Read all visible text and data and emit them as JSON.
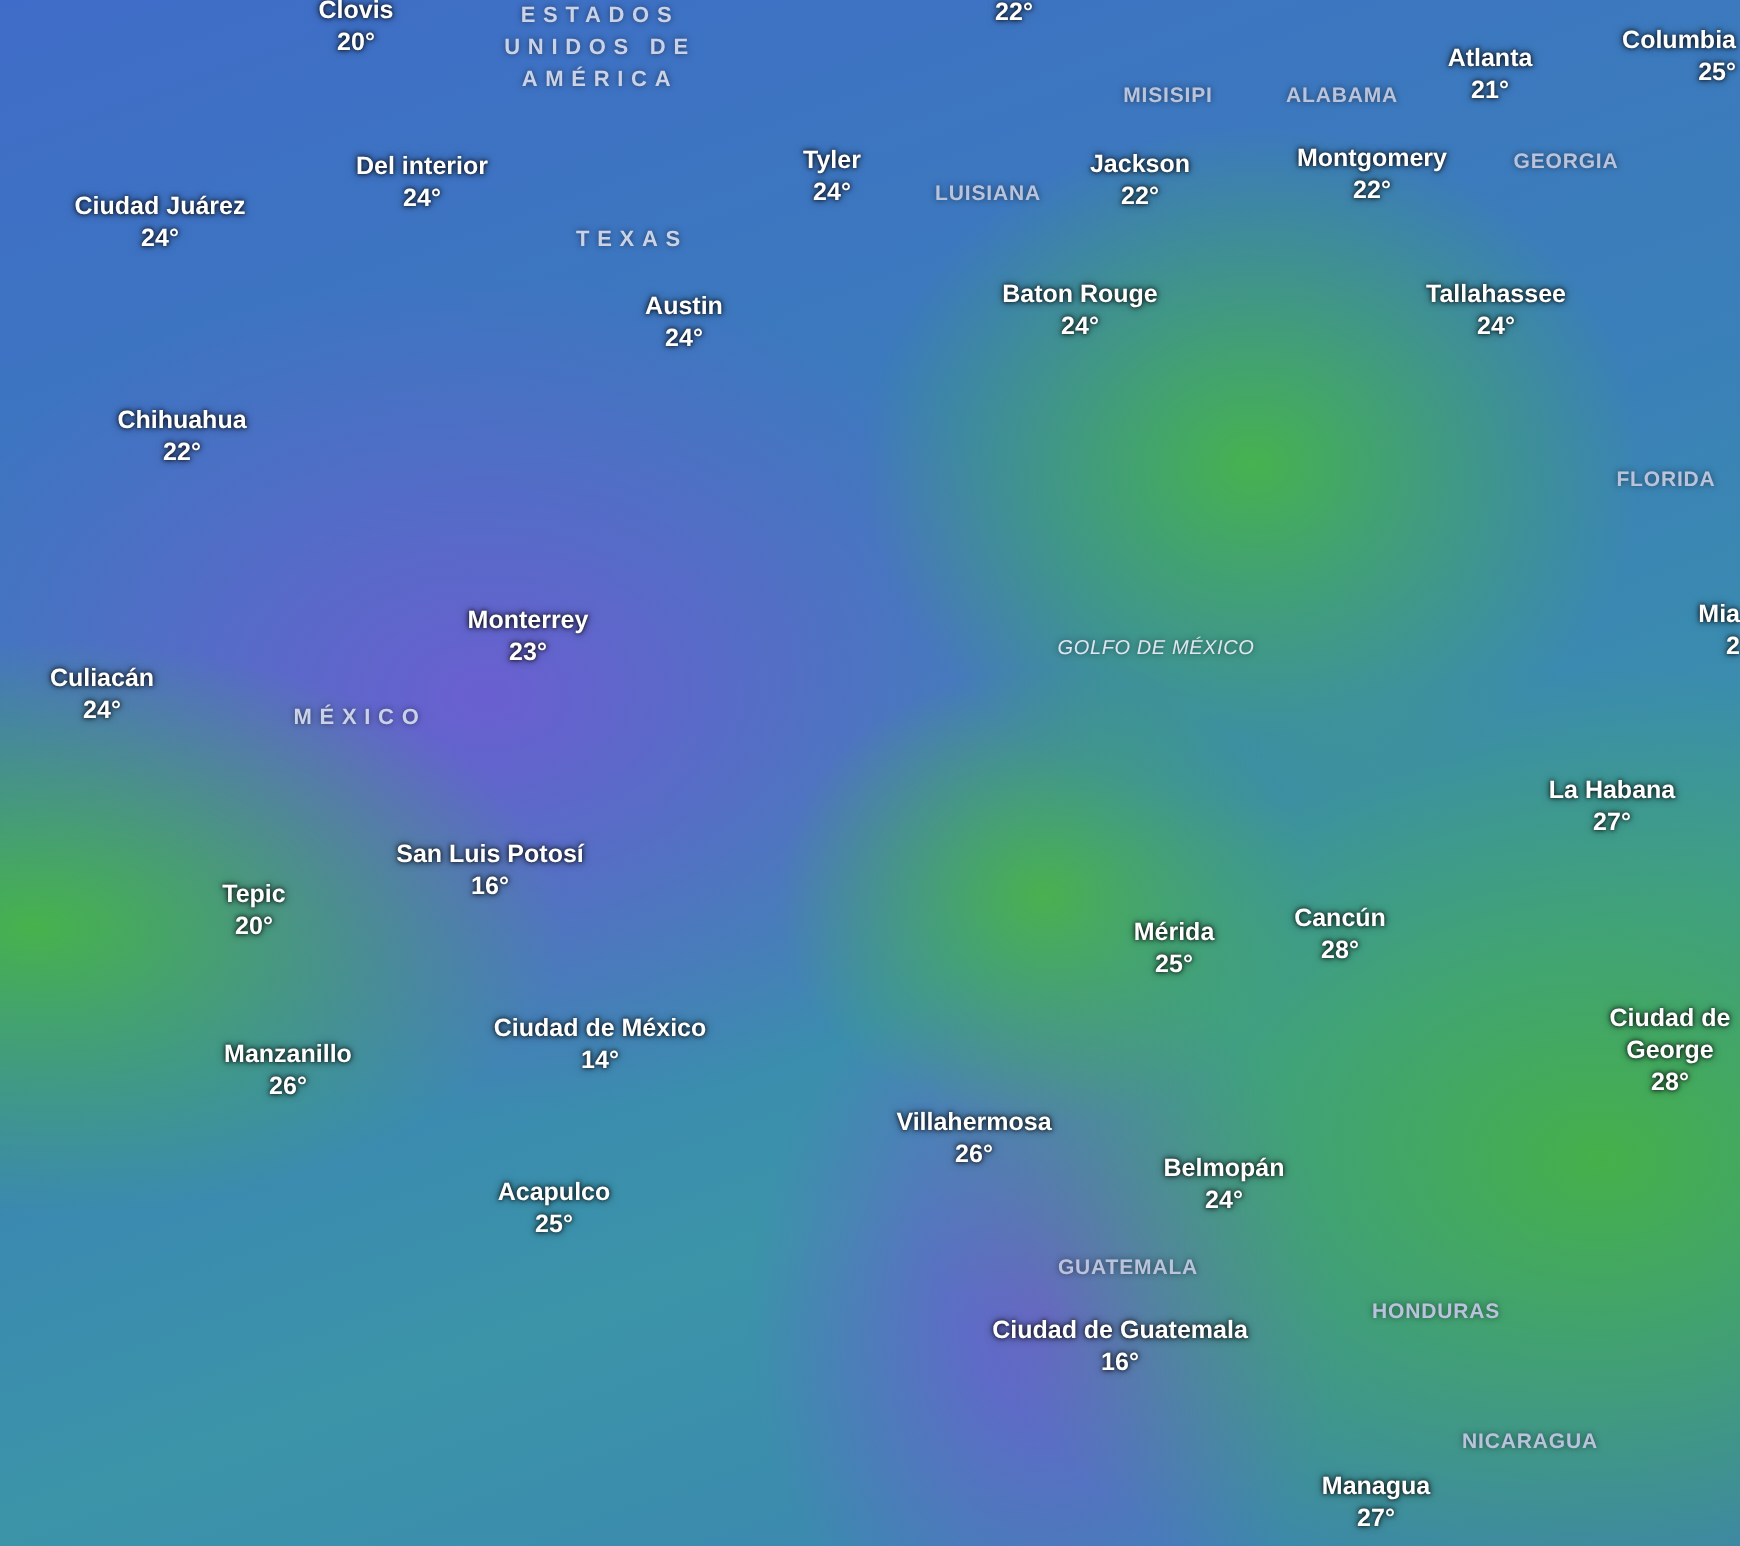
{
  "cities": [
    {
      "kind": "city",
      "name": "Clovis",
      "temp": "20°"
    },
    {
      "kind": "temp",
      "temp": "22°"
    },
    {
      "kind": "city",
      "name": "Columbia",
      "temp": "25°"
    },
    {
      "kind": "city",
      "name": "Atlanta",
      "temp": "21°"
    },
    {
      "kind": "city",
      "name": "Del interior",
      "temp": "24°"
    },
    {
      "kind": "city",
      "name": "Tyler",
      "temp": "24°"
    },
    {
      "kind": "city",
      "name": "Jackson",
      "temp": "22°"
    },
    {
      "kind": "city",
      "name": "Montgomery",
      "temp": "22°"
    },
    {
      "kind": "city",
      "name": "Ciudad Juárez",
      "temp": "24°"
    },
    {
      "kind": "city",
      "name": "Austin",
      "temp": "24°"
    },
    {
      "kind": "city",
      "name": "Baton Rouge",
      "temp": "24°"
    },
    {
      "kind": "city",
      "name": "Tallahassee",
      "temp": "24°"
    },
    {
      "kind": "city",
      "name": "Chihuahua",
      "temp": "22°"
    },
    {
      "kind": "city",
      "name": "Mia",
      "temp": "2"
    },
    {
      "kind": "city",
      "name": "Monterrey",
      "temp": "23°"
    },
    {
      "kind": "city",
      "name": "Culiacán",
      "temp": "24°"
    },
    {
      "kind": "city",
      "name": "La Habana",
      "temp": "27°"
    },
    {
      "kind": "city",
      "name": "San Luis Potosí",
      "temp": "16°"
    },
    {
      "kind": "city",
      "name": "Tepic",
      "temp": "20°"
    },
    {
      "kind": "city",
      "name": "Cancún",
      "temp": "28°"
    },
    {
      "kind": "city",
      "name": "Mérida",
      "temp": "25°"
    },
    {
      "kind": "city",
      "name": "Manzanillo",
      "temp": "26°"
    },
    {
      "kind": "city",
      "name": "Ciudad de México",
      "temp": "14°"
    },
    {
      "kind": "city",
      "name": "Ciudad de George",
      "temp": "28°"
    },
    {
      "kind": "city",
      "name": "Villahermosa",
      "temp": "26°"
    },
    {
      "kind": "city",
      "name": "Belmopán",
      "temp": "24°"
    },
    {
      "kind": "city",
      "name": "Acapulco",
      "temp": "25°"
    },
    {
      "kind": "city",
      "name": "Ciudad de Guatemala",
      "temp": "16°"
    },
    {
      "kind": "city",
      "name": "Managua",
      "temp": "27°"
    }
  ],
  "regions": [
    {
      "kind": "country",
      "name": "ESTADOS UNIDOS DE AMÉRICA"
    },
    {
      "kind": "state",
      "name": "MISISIPI"
    },
    {
      "kind": "state",
      "name": "ALABAMA"
    },
    {
      "kind": "state",
      "name": "GEORGIA"
    },
    {
      "kind": "state",
      "name": "LUISIANA"
    },
    {
      "kind": "country",
      "name": "TEXAS"
    },
    {
      "kind": "state",
      "name": "FLORIDA"
    },
    {
      "kind": "sea",
      "name": "GOLFO DE MÉXICO"
    },
    {
      "kind": "country",
      "name": "MÉXICO"
    },
    {
      "kind": "state",
      "name": "GUATEMALA"
    },
    {
      "kind": "state",
      "name": "HONDURAS"
    },
    {
      "kind": "state",
      "name": "NICARAGUA"
    }
  ]
}
